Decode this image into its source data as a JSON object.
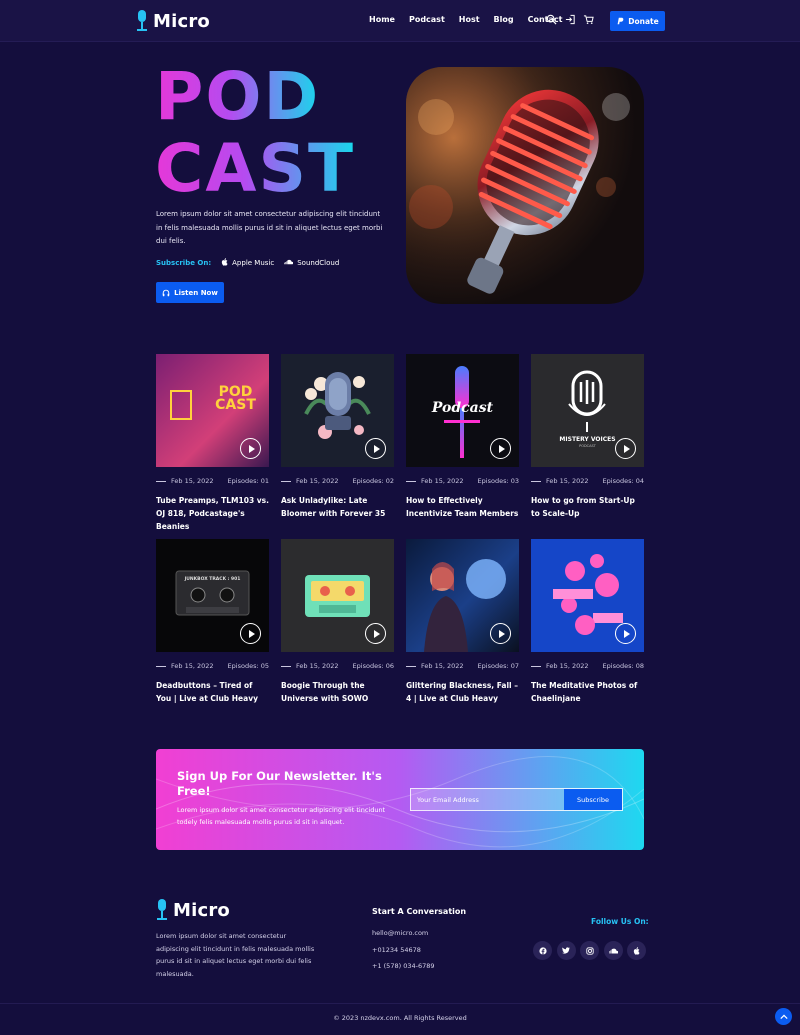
{
  "brand": {
    "name": "Micro"
  },
  "nav": {
    "items": [
      "Home",
      "Podcast",
      "Host",
      "Blog",
      "Contact"
    ],
    "donate_label": "Donate"
  },
  "hero": {
    "title_line1": "POD",
    "title_line2": "CAST",
    "description": "Lorem ipsum dolor sit amet consectetur adipiscing elit tincidunt in felis malesuada mollis purus id sit in aliquet lectus eget morbi dui felis.",
    "subscribe_label": "Subscribe On:",
    "services": [
      "Apple Music",
      "SoundCloud"
    ],
    "listen_label": "Listen Now"
  },
  "episodes": [
    {
      "date": "Feb 15, 2022",
      "episode": "Episodes: 01",
      "title": "Tube Preamps, TLM103 vs. OJ 818, Podcastage's Beanies",
      "art_text": "POD CAST"
    },
    {
      "date": "Feb 15, 2022",
      "episode": "Episodes: 02",
      "title": "Ask Unladylike: Late Bloomer with Forever 35"
    },
    {
      "date": "Feb 15, 2022",
      "episode": "Episodes: 03",
      "title": "How to Effectively Incentivize Team Members",
      "art_text": "Podcast"
    },
    {
      "date": "Feb 15, 2022",
      "episode": "Episodes: 04",
      "title": "How to go from Start-Up to Scale-Up",
      "art_text": "MISTERY VOICES",
      "art_sub": "PODCAST"
    },
    {
      "date": "Feb 15, 2022",
      "episode": "Episodes: 05",
      "title": "Deadbuttons – Tired of You | Live at Club Heavy",
      "art_text": "JUNKBOX TRACK : 901"
    },
    {
      "date": "Feb 15, 2022",
      "episode": "Episodes: 06",
      "title": "Boogie Through the Universe with SOWO"
    },
    {
      "date": "Feb 15, 2022",
      "episode": "Episodes: 07",
      "title": "Glittering Blackness, Fall – 4 | Live at Club Heavy"
    },
    {
      "date": "Feb 15, 2022",
      "episode": "Episodes: 08",
      "title": "The Meditative Photos of Chaelinjane"
    }
  ],
  "newsletter": {
    "title": "Sign Up For Our Newsletter. It's Free!",
    "description": "Lorem ipsum dolor sit amet consectetur adipiscing elit tincidunt todely felis malesuada mollis purus id sit in aliquet.",
    "email_placeholder": "Your Email Address",
    "subscribe_label": "Subscribe"
  },
  "footer": {
    "description": "Lorem ipsum dolor sit amet consectetur adipiscing elit tincidunt in felis malesuada mollis purus id sit in aliquet lectus eget morbi dui felis malesuada.",
    "conversation_title": "Start A Conversation",
    "email": "hello@micro.com",
    "phone1": "+01234 54678",
    "phone2": "+1 (578) 034-6789",
    "follow_label": "Follow Us On:",
    "socials": [
      "facebook-icon",
      "twitter-icon",
      "instagram-icon",
      "soundcloud-icon",
      "apple-icon"
    ],
    "copyright": "© 2023 nzdevx.com. All Rights Reserved"
  },
  "colors": {
    "background": "#140e3d",
    "accent_blue": "#0b5cf0",
    "accent_cyan": "#27c2f4",
    "gradient_pink": "#f13fd3",
    "gradient_cyan": "#1ed8f0"
  }
}
